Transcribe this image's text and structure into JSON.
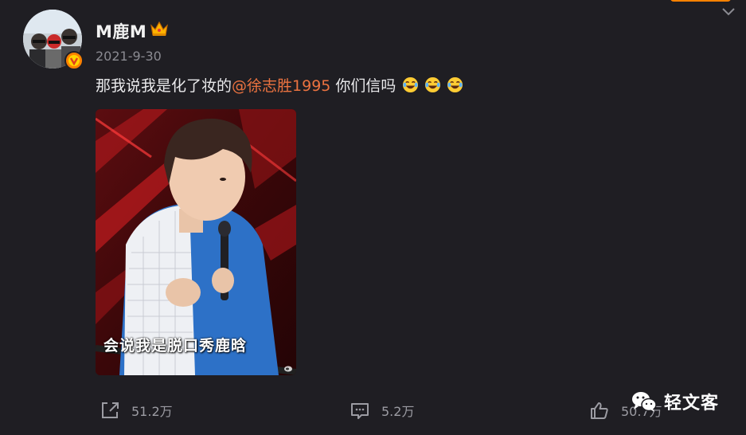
{
  "post": {
    "username": "M鹿M",
    "date": "2021-9-30",
    "text_before": "那我说我是化了妆的",
    "mention": "@徐志胜1995",
    "text_after": " 你们信吗",
    "emojis": [
      "laugh-cry-emoji",
      "laugh-cry-emoji",
      "laugh-cry-emoji"
    ]
  },
  "media": {
    "subtitle": "会说我是脱口秀鹿晗"
  },
  "actions": {
    "repost_count": "51.2万",
    "comment_count": "5.2万",
    "like_count": "50.7万"
  },
  "watermark": {
    "text": "轻文客"
  },
  "colors": {
    "background": "#1f1e23",
    "mention": "#eb7340",
    "muted": "#8b8b92",
    "verified_badge": "#ff8200"
  }
}
